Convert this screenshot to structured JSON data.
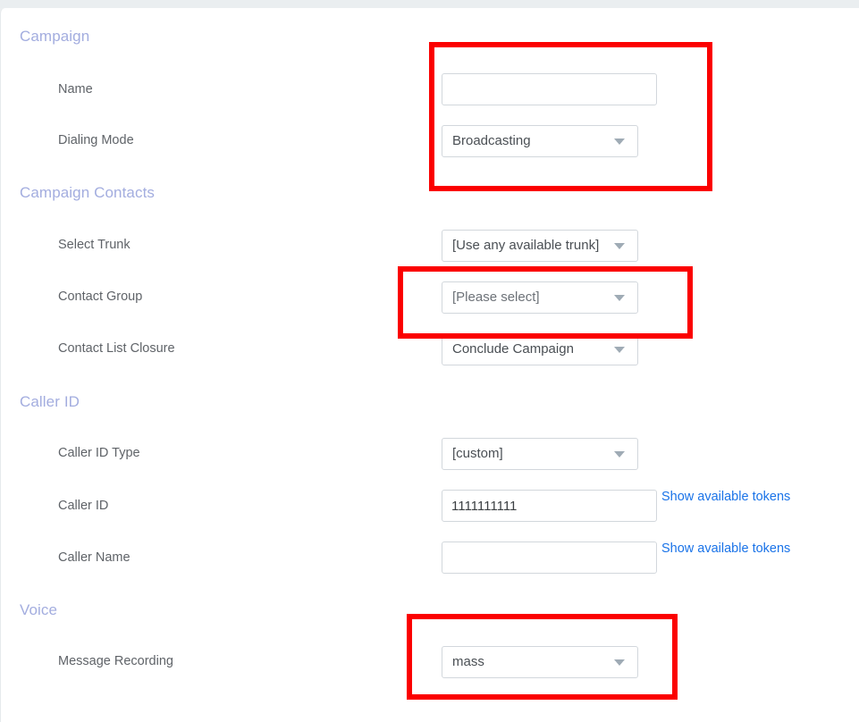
{
  "page": {
    "background_color": "#eceff1",
    "panel_color": "#ffffff",
    "heading_color": "#a3addf",
    "label_color": "#5f6368",
    "link_color": "#1a73e8",
    "highlight_color": "#fb0000"
  },
  "sections": [
    {
      "id": "campaign",
      "title": "Campaign",
      "fields": [
        {
          "id": "name",
          "label": "Name",
          "type": "text",
          "value": "",
          "placeholder": ""
        },
        {
          "id": "dialing-mode",
          "label": "Dialing Mode",
          "type": "select",
          "value": "Broadcasting"
        }
      ]
    },
    {
      "id": "campaign-contacts",
      "title": "Campaign Contacts",
      "fields": [
        {
          "id": "select-trunk",
          "label": "Select Trunk",
          "type": "select",
          "value": "[Use any available trunk]"
        },
        {
          "id": "contact-group",
          "label": "Contact Group",
          "type": "select",
          "value": "[Please select]"
        },
        {
          "id": "contact-list-closure",
          "label": "Contact List Closure",
          "type": "select",
          "value": "Conclude Campaign"
        }
      ]
    },
    {
      "id": "caller-id",
      "title": "Caller ID",
      "fields": [
        {
          "id": "caller-id-type",
          "label": "Caller ID Type",
          "type": "select",
          "value": "[custom]"
        },
        {
          "id": "caller-id",
          "label": "Caller ID",
          "type": "text",
          "value": "1111111111",
          "placeholder": "",
          "link": "Show available tokens"
        },
        {
          "id": "caller-name",
          "label": "Caller Name",
          "type": "text",
          "value": "",
          "placeholder": "",
          "link": "Show available tokens"
        }
      ]
    },
    {
      "id": "voice",
      "title": "Voice",
      "fields": [
        {
          "id": "message-recording",
          "label": "Message Recording",
          "type": "select",
          "value": "mass"
        }
      ]
    }
  ],
  "highlights": [
    {
      "id": "highlight-campaign-fields",
      "label": "Campaign name and dialing mode highlight"
    },
    {
      "id": "highlight-contact-group",
      "label": "Contact group highlight"
    },
    {
      "id": "highlight-message-recording",
      "label": "Message recording highlight"
    }
  ]
}
